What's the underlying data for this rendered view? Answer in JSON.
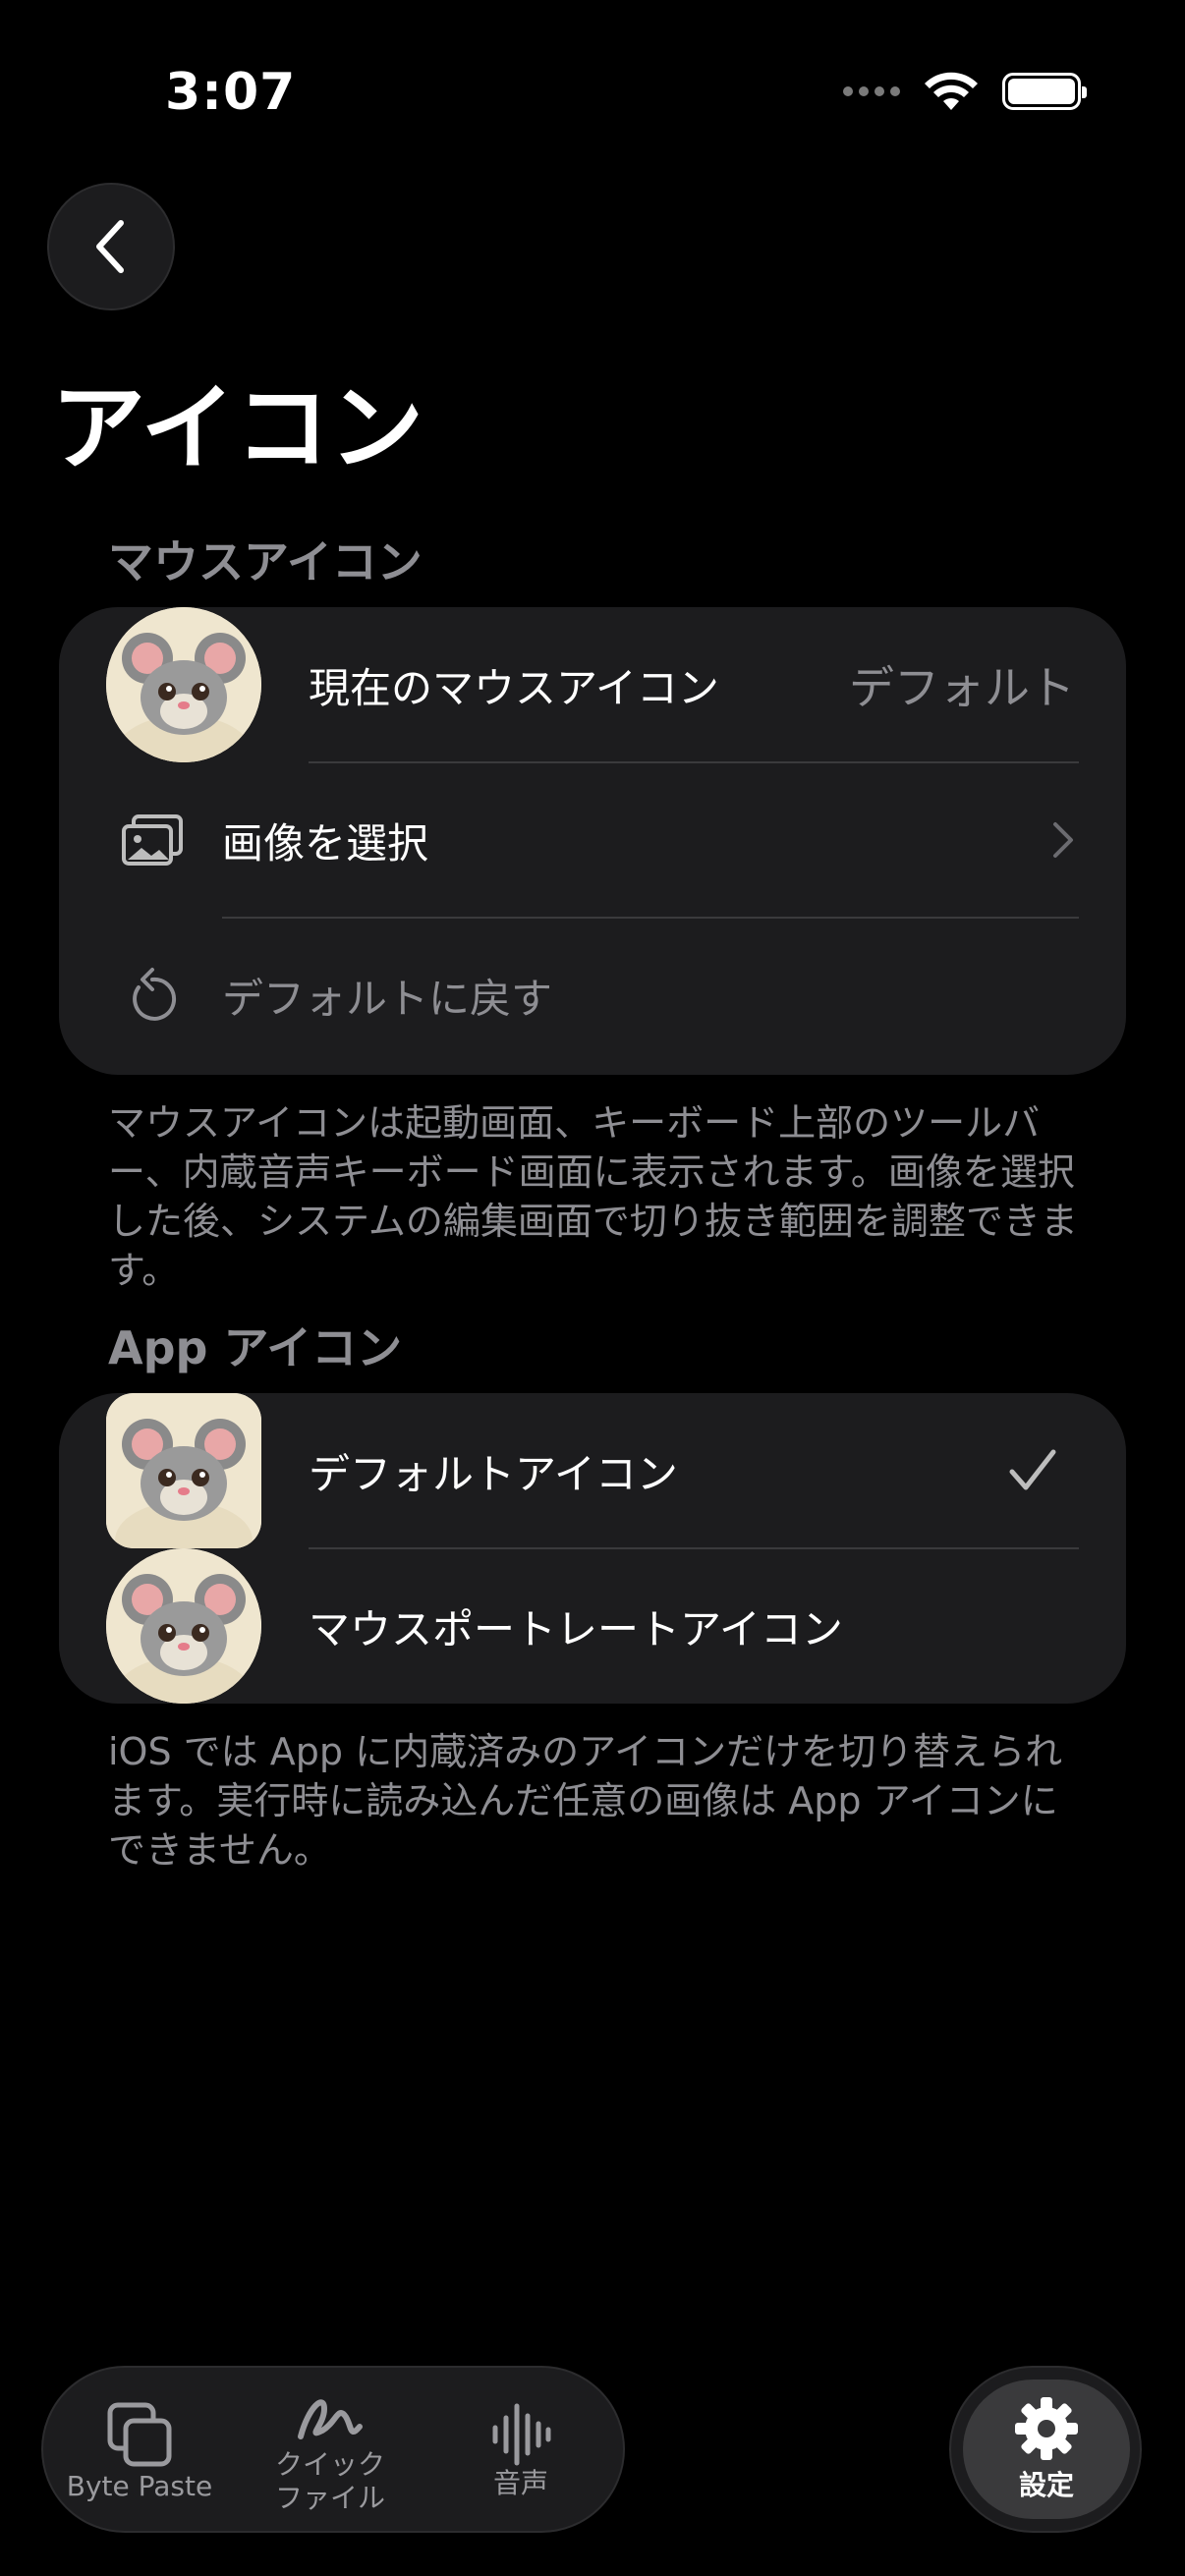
{
  "status": {
    "time": "3:07"
  },
  "page": {
    "title": "アイコン"
  },
  "mouse_section": {
    "header": "マウスアイコン",
    "current_label": "現在のマウスアイコン",
    "current_value": "デフォルト",
    "choose_image_label": "画像を選択",
    "reset_label": "デフォルトに戻す",
    "footnote": "マウスアイコンは起動画面、キーボード上部のツールバー、内蔵音声キーボード画面に表示されます。画像を選択した後、システムの編集画面で切り抜き範囲を調整できます。"
  },
  "app_section": {
    "header": "App アイコン",
    "options": [
      {
        "label": "デフォルトアイコン",
        "selected": true
      },
      {
        "label": "マウスポートレートアイコン",
        "selected": false
      }
    ],
    "footnote": "iOS では App に内蔵済みのアイコンだけを切り替えられます。実行時に読み込んだ任意の画像は App アイコンにできません。"
  },
  "tabbar": {
    "items": [
      {
        "label": "Byte Paste",
        "icon": "copy-icon"
      },
      {
        "label": "クイック\nファイル",
        "icon": "scribble-icon"
      },
      {
        "label": "音声",
        "icon": "waveform-icon"
      }
    ],
    "settings": {
      "label": "設定",
      "icon": "gear-icon"
    }
  },
  "colors": {
    "background": "#000000",
    "card": "#1c1c1e",
    "secondary_text": "#8e8e93",
    "divider": "#3a3a3c"
  }
}
